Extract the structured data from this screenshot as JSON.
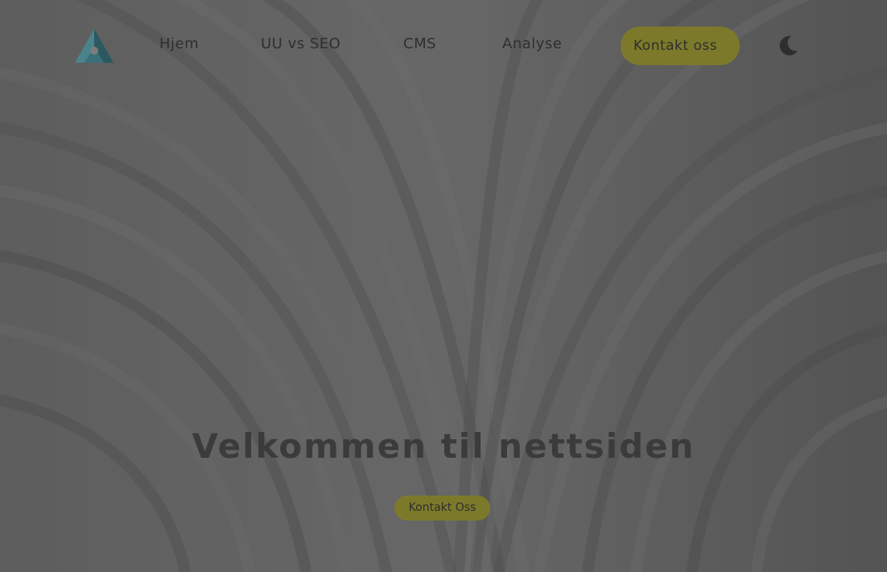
{
  "nav": {
    "items": [
      {
        "label": "Hjem"
      },
      {
        "label": "UU vs SEO"
      },
      {
        "label": "CMS"
      },
      {
        "label": "Analyse"
      }
    ],
    "contact_label": "Kontakt oss",
    "theme_toggle_icon": "moon-icon"
  },
  "hero": {
    "title": "Velkommen til nettsiden",
    "button_label": "Kontakt Oss"
  },
  "colors": {
    "background": "#5f5f5f",
    "accent": "#7c7a2a",
    "text": "#2f2f2f",
    "logo": "#3a6f78"
  }
}
